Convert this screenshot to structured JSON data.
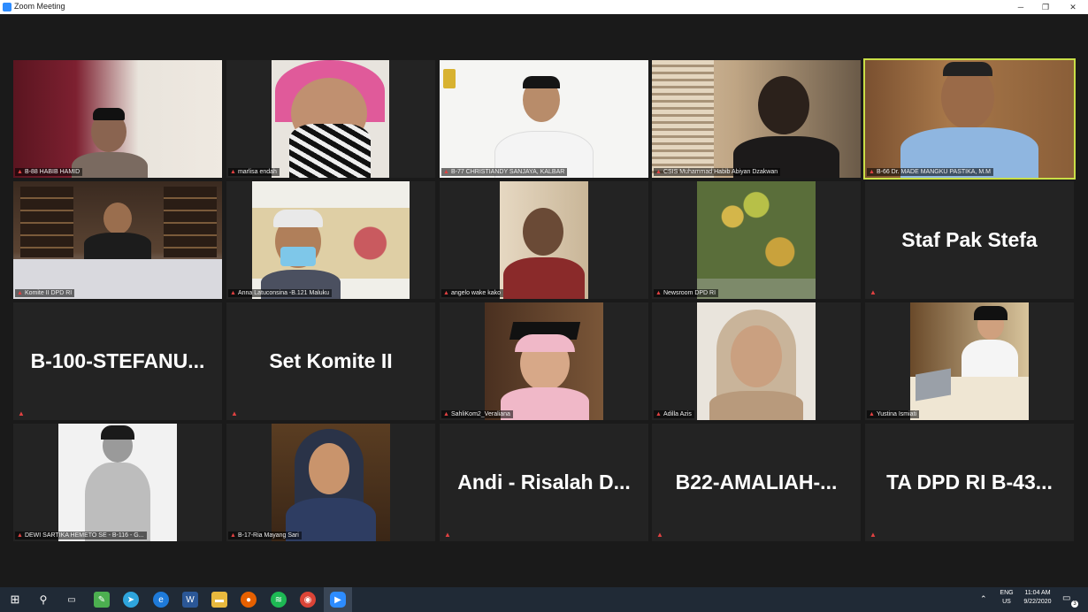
{
  "window": {
    "title": "Zoom Meeting"
  },
  "gallery": {
    "tiles": [
      {
        "label": "B-88 HABIB HAMID"
      },
      {
        "label": "marlisa endah"
      },
      {
        "label": "B-77 CHRISTIANDY SANJAYA, KALBAR"
      },
      {
        "label": "CSIS Muhammad Habib Abiyan Dzakwan"
      },
      {
        "label": "B-66 Dr. MADE MANGKU PASTIKA, M.M"
      },
      {
        "label": "Komite II DPD RI"
      },
      {
        "label": "Anna Latuconsina -B.121 Maluku"
      },
      {
        "label": "angelo wake kako"
      },
      {
        "label": "Newsroom DPD RI"
      },
      {
        "name": "Staf Pak Stefa"
      },
      {
        "name": "B-100-STEFANU..."
      },
      {
        "name": "Set Komite II"
      },
      {
        "label": "SahliKom2_Veraliana"
      },
      {
        "label": "Adilla Azis"
      },
      {
        "label": "Yustina Ismiati"
      },
      {
        "label": "DEWI SARTIKA HEMETO SE - B-116 - G..."
      },
      {
        "label": "B-17-Ria Mayang Sari"
      },
      {
        "name": "Andi - Risalah D..."
      },
      {
        "name": "B22-AMALIAH-..."
      },
      {
        "name": "TA DPD RI B-43..."
      }
    ]
  },
  "taskbar": {
    "lang_top": "ENG",
    "lang_bottom": "US",
    "time": "11:04 AM",
    "date": "9/22/2020",
    "notification_count": "3"
  },
  "colors": {
    "active_speaker": "#c9df46",
    "mute": "#e04141",
    "zoom_blue": "#2d8cff"
  }
}
